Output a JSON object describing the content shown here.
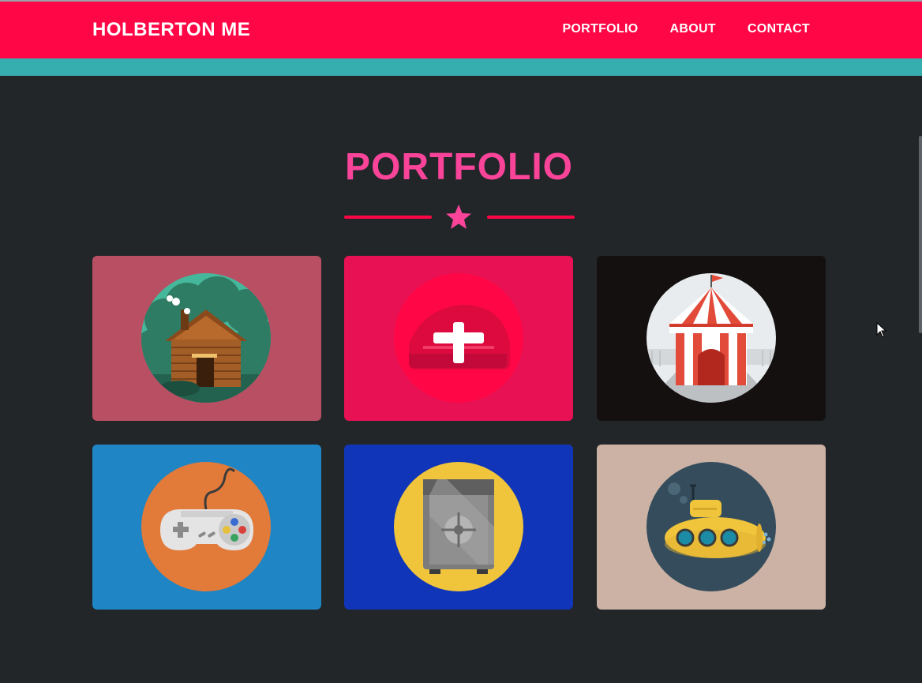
{
  "nav": {
    "brand": "HOLBERTON ME",
    "links": [
      "PORTFOLIO",
      "ABOUT",
      "CONTACT"
    ]
  },
  "portfolio": {
    "title": "PORTFOLIO",
    "items": [
      {
        "icon": "cabin-icon",
        "bg": "#b84f63"
      },
      {
        "icon": "cake-plus-icon",
        "bg": "#e81154"
      },
      {
        "icon": "circus-tent-icon",
        "bg": "#141010"
      },
      {
        "icon": "game-controller-icon",
        "bg": "#1f85c4"
      },
      {
        "icon": "safe-icon",
        "bg": "#1035b8"
      },
      {
        "icon": "submarine-icon",
        "bg": "#ccb2a4"
      }
    ]
  },
  "colors": {
    "navbar": "#ff0746",
    "accent_band": "#36aeb0",
    "background": "#232629",
    "title": "#f9449a"
  }
}
